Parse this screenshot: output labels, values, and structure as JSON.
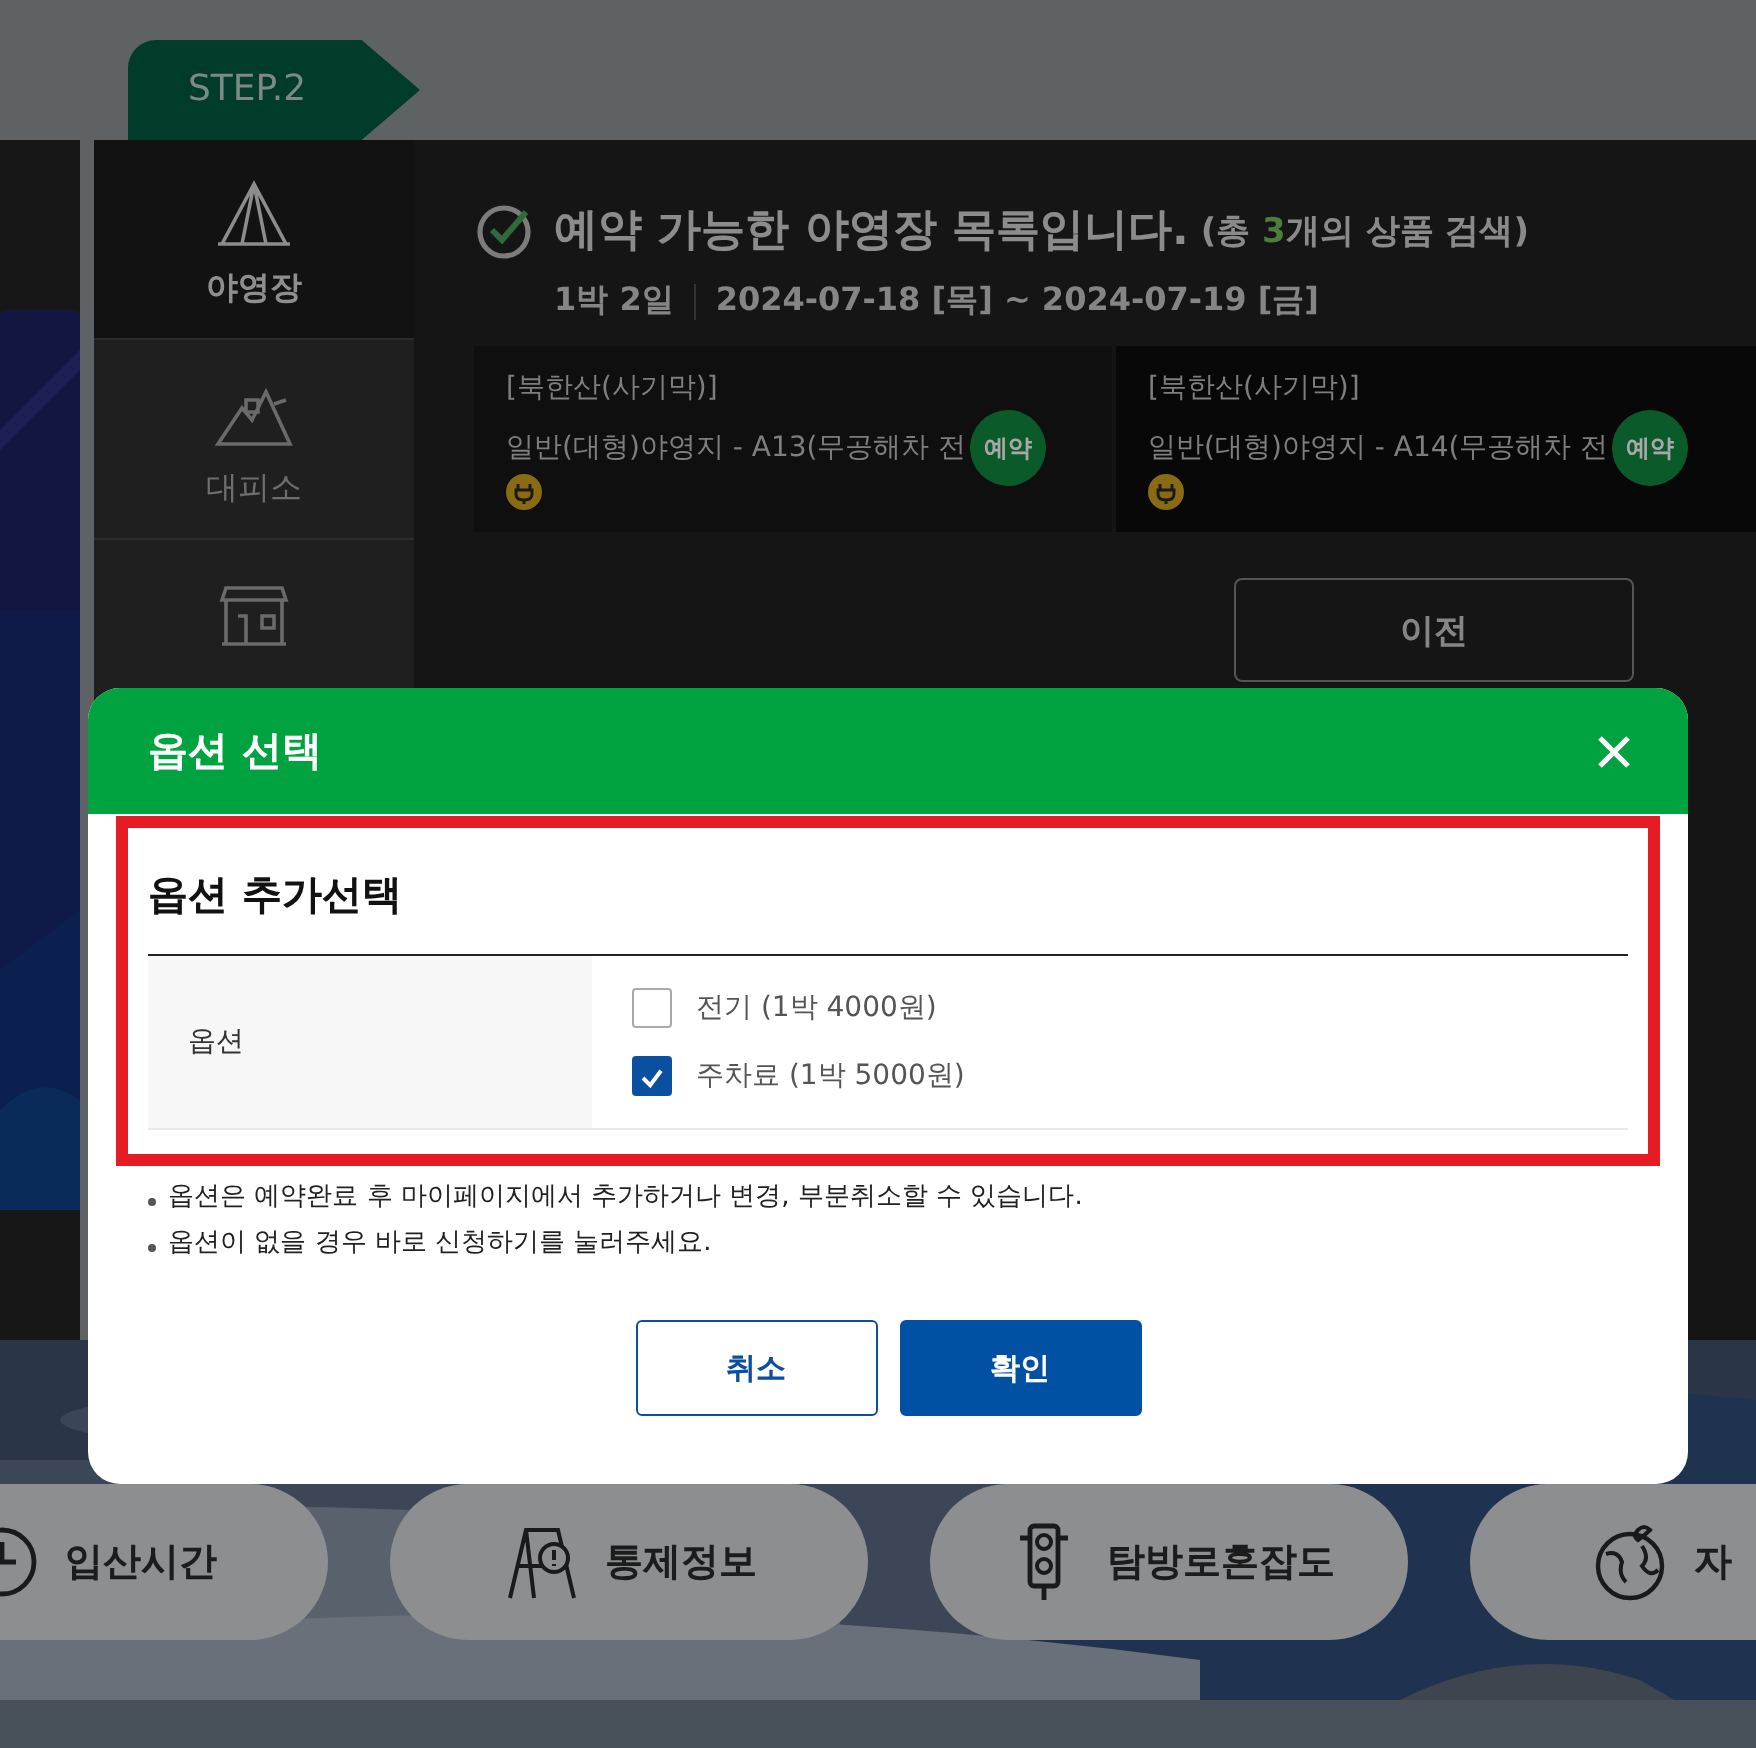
{
  "step_tab": {
    "label": "STEP.2"
  },
  "sidebar": {
    "items": [
      {
        "label": "야영장",
        "selected": true
      },
      {
        "label": "대피소",
        "selected": false
      },
      {
        "selected": false
      }
    ]
  },
  "results": {
    "heading": "예약 가능한 야영장 목록입니다.",
    "summary_open": "(총 ",
    "count": "3",
    "summary_close": "개의 상품 검색)",
    "stay": "1박 2일",
    "dates": "2024-07-18 [목] ~ 2024-07-19 [금]"
  },
  "cards": [
    {
      "area": "[북한산(사기막)]",
      "site": "일반(대형)야영지 - A13(무공해차 전",
      "badge": "예약"
    },
    {
      "area": "[북한산(사기막)]",
      "site": "일반(대형)야영지 - A14(무공해차 전",
      "badge": "예약"
    }
  ],
  "prev_button": "이전",
  "modal": {
    "title": "옵션 선택",
    "section_title": "옵션 추가선택",
    "row_label": "옵션",
    "options": [
      {
        "label": "전기 (1박 4000원)",
        "checked": false
      },
      {
        "label": "주차료 (1박 5000원)",
        "checked": true
      }
    ],
    "notes": [
      "옵션은 예약완료 후 마이페이지에서 추가하거나 변경, 부분취소할 수 있습니다.",
      "옵션이 없을 경우 바로 신청하기를 눌러주세요."
    ],
    "buttons": [
      {
        "label": "취소",
        "kind": "secondary"
      },
      {
        "label": "확인",
        "kind": "primary"
      }
    ]
  },
  "shortcuts": [
    {
      "label": "입산시간"
    },
    {
      "label": "통제정보"
    },
    {
      "label": "탐방로혼잡도"
    },
    {
      "label": "자"
    }
  ]
}
